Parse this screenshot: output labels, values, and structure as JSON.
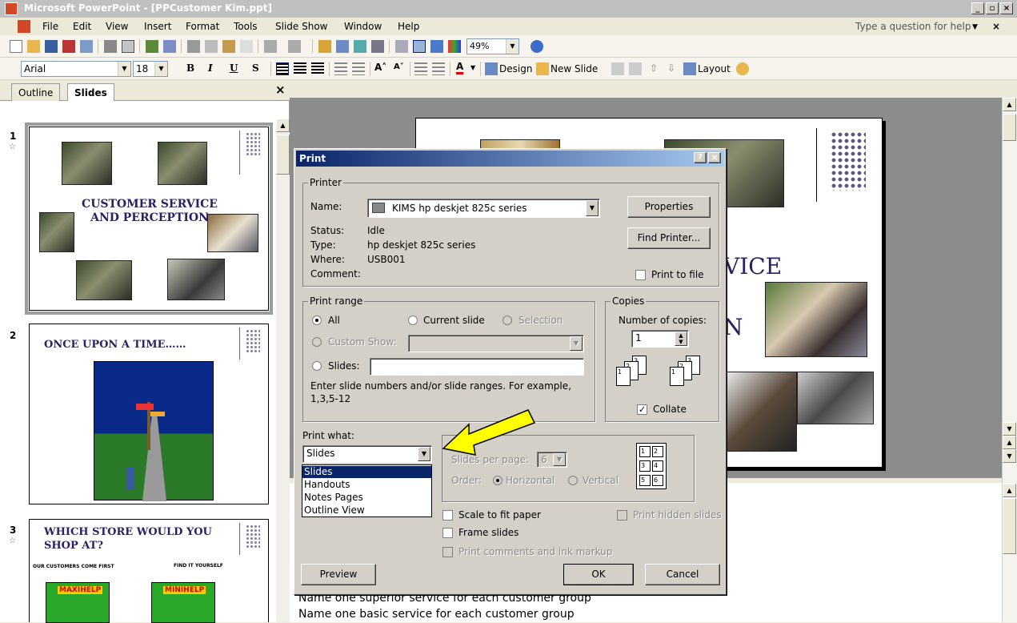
{
  "window": {
    "title": "Microsoft PowerPoint - [PPCustomer Kim.ppt]"
  },
  "menu": {
    "items": [
      "File",
      "Edit",
      "View",
      "Insert",
      "Format",
      "Tools",
      "Slide Show",
      "Window",
      "Help"
    ],
    "help_placeholder": "Type a question for help"
  },
  "toolbar": {
    "zoom": "49%",
    "font": "Arial",
    "font_size": "18",
    "bold": "B",
    "italic": "I",
    "underline": "U",
    "shadow": "S",
    "design": "Design",
    "new_slide": "New Slide",
    "layout": "Layout"
  },
  "panel": {
    "tabs": [
      "Outline",
      "Slides"
    ],
    "active_tab": "Slides",
    "close": "×"
  },
  "slides": [
    {
      "number": "1",
      "title": "CUSTOMER SERVICE AND PERCEPTION"
    },
    {
      "number": "2",
      "title": "ONCE UPON A TIME……"
    },
    {
      "number": "3",
      "title": "WHICH STORE WOULD YOU SHOP AT?",
      "subtitle_left": "OUR CUSTOMERS COME FIRST",
      "subtitle_right": "FIND IT YOURSELF",
      "store_left": "MAXIHELP",
      "store_right": "MINIHELP"
    }
  ],
  "canvas": {
    "title_fragment": "VICE",
    "subtitle_fragment": "N"
  },
  "notes": {
    "line1": "Name one superior service for each customer group",
    "line2": "Name one basic service for each customer group"
  },
  "dialog": {
    "title": "Print",
    "help_btn": "?",
    "close_btn": "×",
    "printer": {
      "group": "Printer",
      "name_label": "Name:",
      "name_value": "KIMS hp deskjet 825c series",
      "status_label": "Status:",
      "status_value": "Idle",
      "type_label": "Type:",
      "type_value": "hp deskjet 825c series",
      "where_label": "Where:",
      "where_value": "USB001",
      "comment_label": "Comment:",
      "properties": "Properties",
      "find_printer": "Find Printer...",
      "print_to_file": "Print to file"
    },
    "range": {
      "group": "Print range",
      "all": "All",
      "current_slide": "Current slide",
      "selection": "Selection",
      "custom_show": "Custom Show:",
      "slides": "Slides:",
      "hint": "Enter slide numbers and/or slide ranges. For example, 1,3,5-12"
    },
    "copies": {
      "group": "Copies",
      "number_label": "Number of copies:",
      "value": "1",
      "collate": "Collate"
    },
    "print_what": {
      "label": "Print what:",
      "value": "Slides",
      "options": [
        "Slides",
        "Handouts",
        "Notes Pages",
        "Outline View"
      ],
      "highlighted": "Slides"
    },
    "handouts": {
      "slides_per_page_label": "Slides per page:",
      "slides_per_page_value": "6",
      "order_label": "Order:",
      "horizontal": "Horizontal",
      "vertical": "Vertical",
      "pages": [
        "1",
        "2",
        "3",
        "4",
        "5",
        "6"
      ]
    },
    "options": {
      "scale": "Scale to fit paper",
      "frame": "Frame slides",
      "comments": "Print comments and ink markup",
      "hidden": "Print hidden slides"
    },
    "buttons": {
      "preview": "Preview",
      "ok": "OK",
      "cancel": "Cancel"
    }
  },
  "colors": {
    "dialog_title_start": "#0a246a",
    "dialog_title_end": "#a6caf0",
    "arrow": "#ffff00",
    "slide_title": "#2b2063",
    "selection": "#0a246a"
  }
}
